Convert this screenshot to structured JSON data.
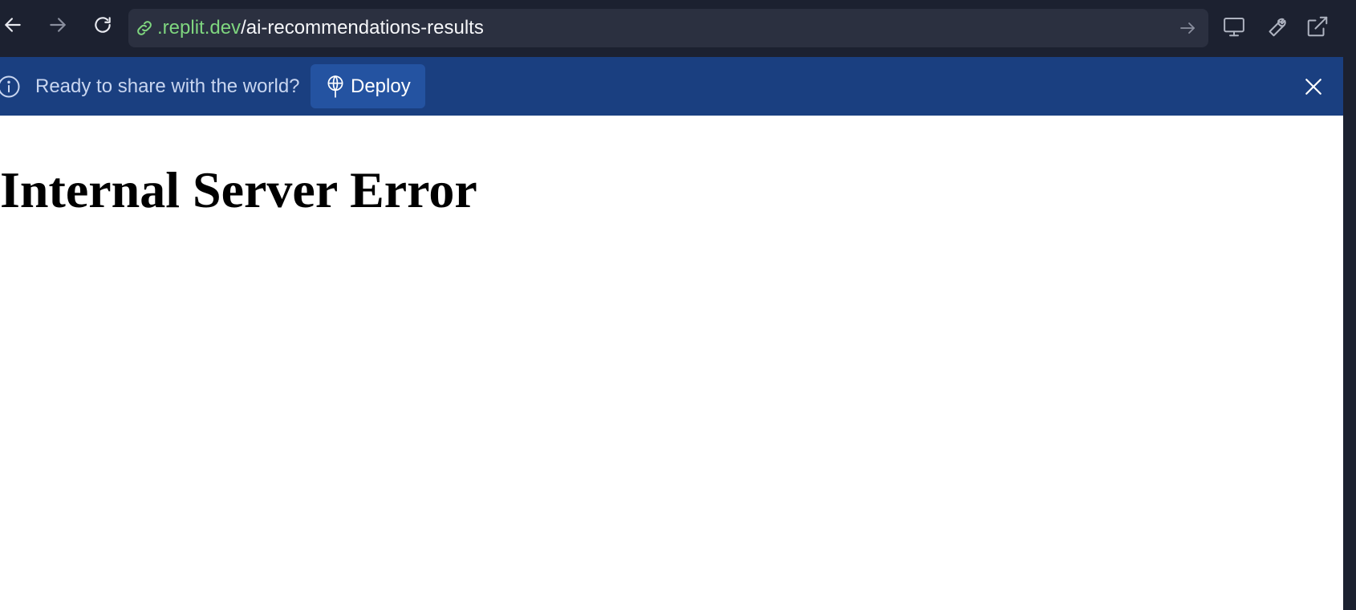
{
  "browser": {
    "url_domain": ".replit.dev",
    "url_path": "/ai-recommendations-results",
    "icons": {
      "back": "arrow-left-icon",
      "forward": "arrow-right-icon",
      "reload": "reload-icon",
      "link": "link-icon",
      "go": "arrow-right-icon",
      "devices": "monitor-icon",
      "devtools": "wrench-icon",
      "open_external": "external-link-icon"
    }
  },
  "banner": {
    "message": "Ready to share with the world?",
    "deploy_label": "Deploy",
    "icons": {
      "info": "info-icon",
      "deploy": "deploy-icon",
      "close": "close-icon"
    }
  },
  "page": {
    "title": "Internal Server Error"
  },
  "colors": {
    "toolbar_bg": "#1c2130",
    "url_bar_bg": "#2b3040",
    "url_domain": "#7fd67f",
    "banner_bg": "#1a3f80",
    "deploy_bg": "#2453a1"
  }
}
